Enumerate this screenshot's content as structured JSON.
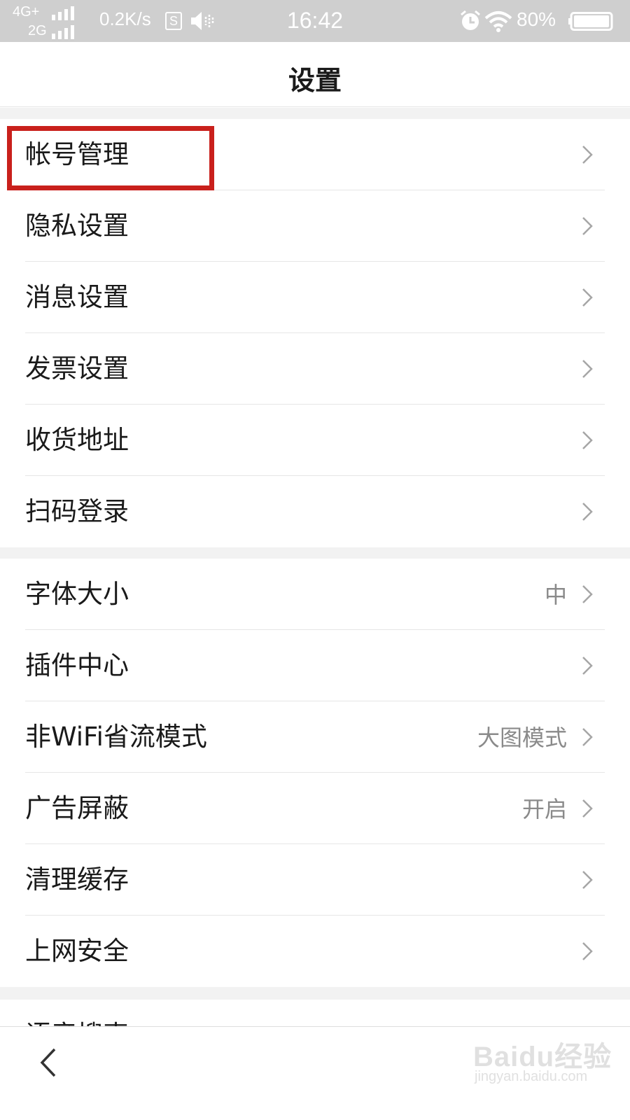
{
  "status_bar": {
    "network_top": "4G+",
    "network_bottom": "2G",
    "speed": "0.2K/s",
    "s_icon_letter": "S",
    "time": "16:42",
    "battery_percent": "80%",
    "icons": [
      "signal-icon",
      "signal-icon",
      "s-app-icon",
      "vibrate-icon",
      "alarm-icon",
      "wifi-icon",
      "battery-icon"
    ]
  },
  "header": {
    "title": "设置"
  },
  "groups": [
    {
      "items": [
        {
          "label": "帐号管理",
          "value": ""
        },
        {
          "label": "隐私设置",
          "value": ""
        },
        {
          "label": "消息设置",
          "value": ""
        },
        {
          "label": "发票设置",
          "value": ""
        },
        {
          "label": "收货地址",
          "value": ""
        },
        {
          "label": "扫码登录",
          "value": ""
        }
      ]
    },
    {
      "items": [
        {
          "label": "字体大小",
          "value": "中"
        },
        {
          "label": "插件中心",
          "value": ""
        },
        {
          "label": "非WiFi省流模式",
          "value": "大图模式"
        },
        {
          "label": "广告屏蔽",
          "value": "开启"
        },
        {
          "label": "清理缓存",
          "value": ""
        },
        {
          "label": "上网安全",
          "value": ""
        }
      ]
    }
  ],
  "partial_item": {
    "label": "语音搜索"
  },
  "annotation": {
    "highlight_color": "#c9201c",
    "highlighted_item": "帐号管理"
  },
  "bottom_bar": {
    "back_icon": "back-arrow-icon"
  },
  "watermark": {
    "main": "Baidu经验",
    "sub": "jingyan.baidu.com"
  },
  "colors": {
    "text": "#1a1a1a",
    "value_text": "#8a8a8a",
    "gap": "#f2f2f2",
    "status_bar": "#cfcfcf"
  }
}
